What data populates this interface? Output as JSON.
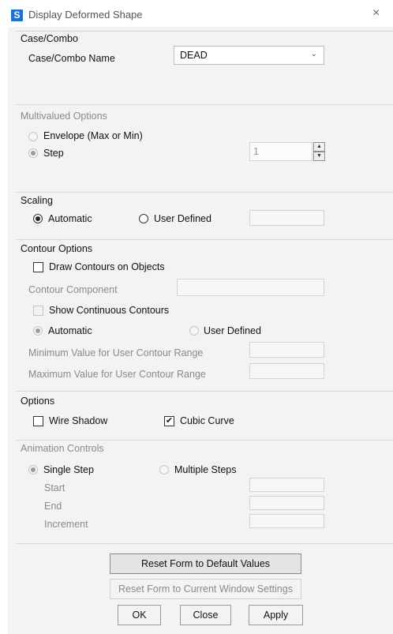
{
  "window": {
    "title": "Display Deformed Shape",
    "app_icon_letter": "S",
    "close_glyph": "×"
  },
  "case_combo": {
    "title": "Case/Combo",
    "name_label": "Case/Combo Name",
    "selected": "DEAD"
  },
  "multivalued": {
    "title": "Multivalued Options",
    "envelope_label": "Envelope (Max or Min)",
    "step_label": "Step",
    "step_value": "1"
  },
  "scaling": {
    "title": "Scaling",
    "automatic_label": "Automatic",
    "user_defined_label": "User Defined"
  },
  "contour": {
    "title": "Contour Options",
    "draw_contours_label": "Draw Contours on Objects",
    "component_label": "Contour Component",
    "show_continuous_label": "Show Continuous Contours",
    "automatic_label": "Automatic",
    "user_defined_label": "User Defined",
    "min_label": "Minimum Value for User Contour Range",
    "max_label": "Maximum Value for User Contour Range"
  },
  "options": {
    "title": "Options",
    "wire_shadow_label": "Wire Shadow",
    "cubic_curve_label": "Cubic Curve",
    "cubic_curve_checked": true
  },
  "animation": {
    "title": "Animation Controls",
    "single_step_label": "Single Step",
    "multiple_steps_label": "Multiple Steps",
    "start_label": "Start",
    "end_label": "End",
    "increment_label": "Increment"
  },
  "buttons": {
    "reset_default": "Reset Form to Default Values",
    "reset_current": "Reset Form to Current Window Settings",
    "ok": "OK",
    "close": "Close",
    "apply": "Apply"
  }
}
